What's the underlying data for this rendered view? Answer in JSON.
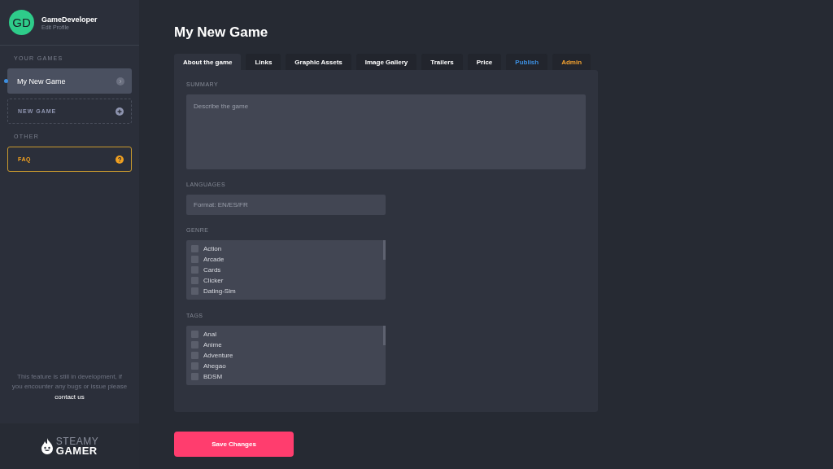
{
  "profile": {
    "initials": "GD",
    "name": "GameDeveloper",
    "link": "Edit Profile"
  },
  "sidebar": {
    "sections": [
      {
        "title": "YOUR GAMES",
        "items": [
          {
            "label": "My New Game",
            "kind": "game",
            "selected": true
          },
          {
            "label": "NEW GAME",
            "kind": "new",
            "selected": false
          }
        ]
      },
      {
        "title": "OTHER",
        "items": [
          {
            "label": "FAQ",
            "kind": "faq",
            "selected": false
          }
        ]
      }
    ],
    "note": {
      "text": "This feature is still in development, if you encounter any bugs or issue please",
      "link": "contact us"
    },
    "logo": {
      "top": "STEAMY",
      "bottom": "GAMER"
    }
  },
  "title": "My New Game",
  "tabs": [
    {
      "label": "About the game",
      "selected": true,
      "color": "#ffffff"
    },
    {
      "label": "Links",
      "selected": false,
      "color": "#ffffff"
    },
    {
      "label": "Graphic Assets",
      "selected": false,
      "color": "#ffffff"
    },
    {
      "label": "Image Gallery",
      "selected": false,
      "color": "#ffffff"
    },
    {
      "label": "Trailers",
      "selected": false,
      "color": "#ffffff"
    },
    {
      "label": "Price",
      "selected": false,
      "color": "#ffffff"
    },
    {
      "label": "Publish",
      "selected": false,
      "color": "#3d8fe0"
    },
    {
      "label": "Admin",
      "selected": false,
      "color": "#f0a030"
    }
  ],
  "form": [
    {
      "kind": "textarea",
      "label": "SUMMARY",
      "placeholder": "Describe the game"
    },
    {
      "kind": "input",
      "label": "LANGUAGES",
      "placeholder": "Format: EN/ES/FR"
    },
    {
      "kind": "checklist",
      "label": "GENRE",
      "options": [
        {
          "label": "Action",
          "checked": false
        },
        {
          "label": "Arcade",
          "checked": false
        },
        {
          "label": "Cards",
          "checked": false
        },
        {
          "label": "Clicker",
          "checked": false
        },
        {
          "label": "Dating-Sim",
          "checked": false
        }
      ]
    },
    {
      "kind": "checklist",
      "label": "TAGS",
      "options": [
        {
          "label": "Anal",
          "checked": false
        },
        {
          "label": "Anime",
          "checked": false
        },
        {
          "label": "Adventure",
          "checked": false
        },
        {
          "label": "Ahegao",
          "checked": false
        },
        {
          "label": "BDSM",
          "checked": false
        }
      ]
    }
  ],
  "save_button": "Save Changes"
}
